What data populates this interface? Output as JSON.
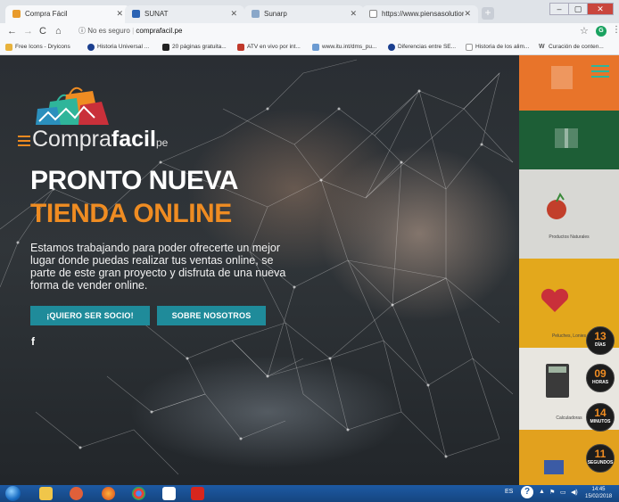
{
  "browser": {
    "tabs": [
      {
        "title": "Compra Fácil",
        "active": true,
        "favicon_color": "#e89b2c"
      },
      {
        "title": "SUNAT",
        "active": false,
        "favicon_color": "#2b63b4"
      },
      {
        "title": "Sunarp",
        "active": false,
        "favicon_color": "#8aa7c9"
      },
      {
        "title": "https://www.piensasolutions.com",
        "active": false,
        "favicon_color": "#888888"
      }
    ],
    "new_tab": "+",
    "window_controls": {
      "minimize": "–",
      "maximize": "▢",
      "close": "✕"
    },
    "address": {
      "security": "No es seguro",
      "domain": "comprafacil.pe"
    },
    "profile_initial": "G",
    "bookmarks": [
      {
        "label": "Free Icons - Dryicons",
        "color": "#e8b23c"
      },
      {
        "label": "Historia Universal ...",
        "color": "#1b3f8f"
      },
      {
        "label": "20 páginas gratuita...",
        "color": "#222222"
      },
      {
        "label": "ATV en vivo por int...",
        "color": "#c0392b"
      },
      {
        "label": "www.itu.int/dms_pu...",
        "color": "#6c9bd2"
      },
      {
        "label": "Diferencias entre SE...",
        "color": "#1b3f8f"
      },
      {
        "label": "Historia de los alim...",
        "color": "#999999"
      },
      {
        "label": "Curación de conten...",
        "color": "#555555"
      }
    ]
  },
  "hero": {
    "logo": {
      "word_a": "Compra",
      "word_b": "facil",
      "suffix": "pe"
    },
    "headline_1": "PRONTO NUEVA",
    "headline_2": "TIENDA ONLINE",
    "description": "Estamos trabajando para poder ofrecerte un mejor lugar donde puedas realizar tus ventas online, se parte de este gran proyecto y disfruta de una nueva forma de vender online.",
    "buttons": {
      "partner": "¡QUIERO SER SOCIO!",
      "about": "SOBRE NOSOTROS"
    },
    "social_facebook": "f"
  },
  "product_column": {
    "captions": [
      "Productos Naturales",
      "Peluches, Lonies",
      "Calculadoras"
    ]
  },
  "countdown": [
    {
      "value": "13",
      "label": "DÍAS"
    },
    {
      "value": "09",
      "label": "HORAS"
    },
    {
      "value": "14",
      "label": "MINUTOS"
    },
    {
      "value": "11",
      "label": "SEGUNDOS"
    }
  ],
  "colors": {
    "accent_orange": "#ef8c22",
    "button_teal": "#1f8b9a",
    "menu_green": "#2fb59a"
  },
  "taskbar": {
    "language": "ES",
    "time": "14:45",
    "date": "15/02/2018"
  }
}
